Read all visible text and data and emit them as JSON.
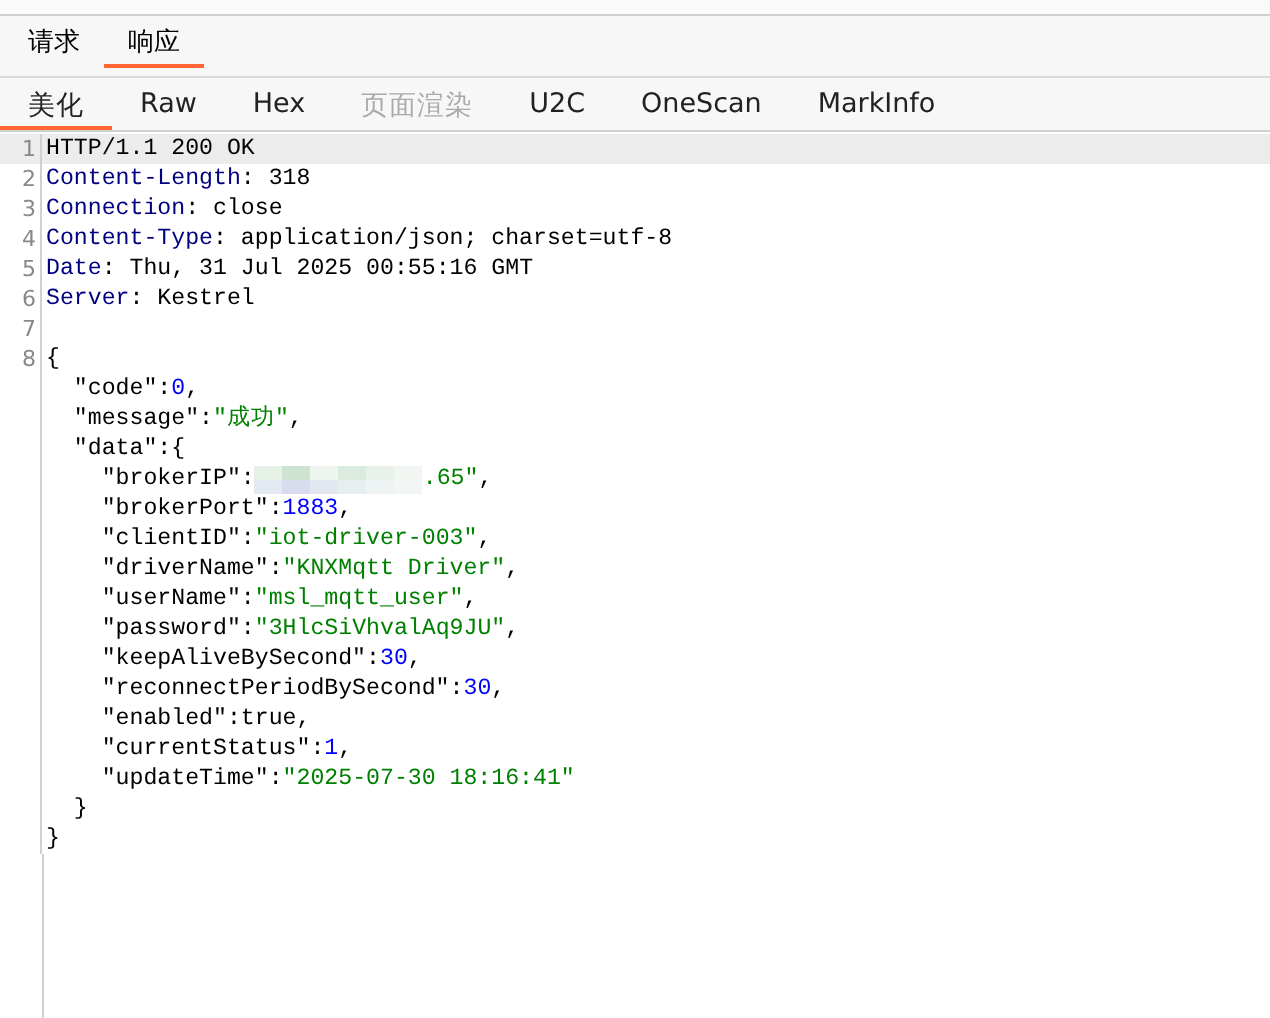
{
  "tabs": [
    {
      "label": "请求",
      "selected": false
    },
    {
      "label": "响应",
      "selected": true
    }
  ],
  "view_tabs": [
    {
      "label": "美化",
      "selected": true,
      "disabled": false
    },
    {
      "label": "Raw",
      "selected": false,
      "disabled": false
    },
    {
      "label": "Hex",
      "selected": false,
      "disabled": false
    },
    {
      "label": "页面渲染",
      "selected": false,
      "disabled": true
    },
    {
      "label": "U2C",
      "selected": false,
      "disabled": false
    },
    {
      "label": "OneScan",
      "selected": false,
      "disabled": false
    },
    {
      "label": "MarkInfo",
      "selected": false,
      "disabled": false
    }
  ],
  "editor": {
    "lines": [
      {
        "number": "1",
        "highlighted": true,
        "tokens": [
          {
            "kind": "plain",
            "text": "HTTP/1.1 200 OK"
          }
        ]
      },
      {
        "number": "2",
        "highlighted": false,
        "tokens": [
          {
            "kind": "header",
            "text": "Content-Length"
          },
          {
            "kind": "plain",
            "text": ": 318"
          }
        ]
      },
      {
        "number": "3",
        "highlighted": false,
        "tokens": [
          {
            "kind": "header",
            "text": "Connection"
          },
          {
            "kind": "plain",
            "text": ": close"
          }
        ]
      },
      {
        "number": "4",
        "highlighted": false,
        "tokens": [
          {
            "kind": "header",
            "text": "Content-Type"
          },
          {
            "kind": "plain",
            "text": ": application/json; charset=utf-8"
          }
        ]
      },
      {
        "number": "5",
        "highlighted": false,
        "tokens": [
          {
            "kind": "header",
            "text": "Date"
          },
          {
            "kind": "plain",
            "text": ": Thu, 31 Jul 2025 00:55:16 GMT"
          }
        ]
      },
      {
        "number": "6",
        "highlighted": false,
        "tokens": [
          {
            "kind": "header",
            "text": "Server"
          },
          {
            "kind": "plain",
            "text": ": Kestrel"
          }
        ]
      },
      {
        "number": "7",
        "highlighted": false
      },
      {
        "number": "8",
        "highlighted": false,
        "tokens": [
          {
            "kind": "plain",
            "text": "{"
          }
        ]
      },
      {
        "highlighted": false,
        "tokens": [
          {
            "kind": "plain",
            "text": "  \"code\":"
          },
          {
            "kind": "number",
            "text": "0"
          },
          {
            "kind": "plain",
            "text": ","
          }
        ]
      },
      {
        "highlighted": false,
        "tokens": [
          {
            "kind": "plain",
            "text": "  \"message\":"
          },
          {
            "kind": "string",
            "text": "\"成功\""
          },
          {
            "kind": "plain",
            "text": ","
          }
        ]
      },
      {
        "highlighted": false,
        "tokens": [
          {
            "kind": "plain",
            "text": "  \"data\":{"
          }
        ]
      },
      {
        "highlighted": false,
        "tokens": [
          {
            "kind": "plain",
            "text": "    \"brokerIP\":"
          },
          {
            "kind": "redaction"
          },
          {
            "kind": "string",
            "text": ".65\""
          },
          {
            "kind": "plain",
            "text": ","
          }
        ]
      },
      {
        "highlighted": false,
        "tokens": [
          {
            "kind": "plain",
            "text": "    \"brokerPort\":"
          },
          {
            "kind": "number",
            "text": "1883"
          },
          {
            "kind": "plain",
            "text": ","
          }
        ]
      },
      {
        "highlighted": false,
        "tokens": [
          {
            "kind": "plain",
            "text": "    \"clientID\":"
          },
          {
            "kind": "string",
            "text": "\"iot-driver-003\""
          },
          {
            "kind": "plain",
            "text": ","
          }
        ]
      },
      {
        "highlighted": false,
        "tokens": [
          {
            "kind": "plain",
            "text": "    \"driverName\":"
          },
          {
            "kind": "string",
            "text": "\"KNXMqtt Driver\""
          },
          {
            "kind": "plain",
            "text": ","
          }
        ]
      },
      {
        "highlighted": false,
        "tokens": [
          {
            "kind": "plain",
            "text": "    \"userName\":"
          },
          {
            "kind": "string",
            "text": "\"msl_mqtt_user\""
          },
          {
            "kind": "plain",
            "text": ","
          }
        ]
      },
      {
        "highlighted": false,
        "tokens": [
          {
            "kind": "plain",
            "text": "    \"password\":"
          },
          {
            "kind": "string",
            "text": "\"3HlcSiVhvalAq9JU\""
          },
          {
            "kind": "plain",
            "text": ","
          }
        ]
      },
      {
        "highlighted": false,
        "tokens": [
          {
            "kind": "plain",
            "text": "    \"keepAliveBySecond\":"
          },
          {
            "kind": "number",
            "text": "30"
          },
          {
            "kind": "plain",
            "text": ","
          }
        ]
      },
      {
        "highlighted": false,
        "tokens": [
          {
            "kind": "plain",
            "text": "    \"reconnectPeriodBySecond\":"
          },
          {
            "kind": "number",
            "text": "30"
          },
          {
            "kind": "plain",
            "text": ","
          }
        ]
      },
      {
        "highlighted": false,
        "tokens": [
          {
            "kind": "plain",
            "text": "    \"enabled\":true,"
          }
        ]
      },
      {
        "highlighted": false,
        "tokens": [
          {
            "kind": "plain",
            "text": "    \"currentStatus\":"
          },
          {
            "kind": "number",
            "text": "1"
          },
          {
            "kind": "plain",
            "text": ","
          }
        ]
      },
      {
        "highlighted": false,
        "tokens": [
          {
            "kind": "plain",
            "text": "    \"updateTime\":"
          },
          {
            "kind": "string",
            "text": "\"2025-07-30 18:16:41\""
          }
        ]
      },
      {
        "highlighted": false,
        "tokens": [
          {
            "kind": "plain",
            "text": "  }"
          }
        ]
      },
      {
        "highlighted": false,
        "tokens": [
          {
            "kind": "plain",
            "text": "}"
          }
        ]
      }
    ]
  }
}
